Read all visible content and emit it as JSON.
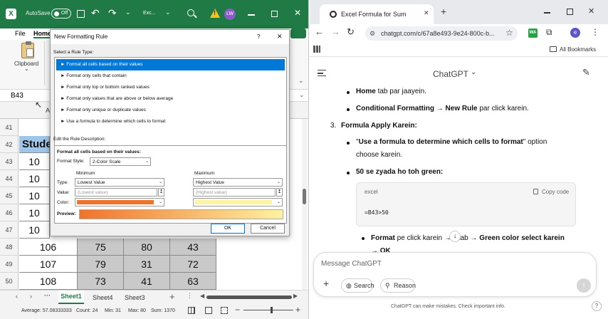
{
  "excel": {
    "autosave_label": "AutoSave",
    "autosave_state": "Off",
    "filename": "Exc...",
    "user_initials": "LW",
    "ribbon_tabs": [
      "File",
      "Home"
    ],
    "clipboard_label": "Clipboard",
    "namebox": "B43",
    "col_a": "A",
    "rows": [
      {
        "num": "41",
        "cells": []
      },
      {
        "num": "42",
        "cells": [
          "Stude"
        ]
      },
      {
        "num": "43",
        "cells": [
          "10"
        ]
      },
      {
        "num": "44",
        "cells": [
          "10"
        ]
      },
      {
        "num": "45",
        "cells": [
          "10"
        ]
      },
      {
        "num": "46",
        "cells": [
          "10"
        ]
      },
      {
        "num": "47",
        "cells": [
          "10"
        ]
      },
      {
        "num": "48",
        "cells": [
          "106",
          "75",
          "80",
          "43"
        ]
      },
      {
        "num": "49",
        "cells": [
          "107",
          "79",
          "31",
          "72"
        ]
      },
      {
        "num": "50",
        "cells": [
          "108",
          "73",
          "41",
          "63"
        ]
      }
    ],
    "sheets": [
      "Sheet1",
      "Sheet4",
      "Sheet3"
    ],
    "active_sheet": "Sheet1",
    "status": {
      "average": "Average: 57.08333333",
      "count": "Count: 24",
      "min": "Min: 31",
      "max": "Max: 80",
      "sum": "Sum: 1370"
    }
  },
  "dialog": {
    "title": "New Formatting Rule",
    "help": "?",
    "close": "✕",
    "select_rule_label": "Select a Rule Type:",
    "rule_types": [
      "► Format all cells based on their values",
      "► Format only cells that contain",
      "► Format only top or bottom ranked values",
      "► Format only values that are above or below average",
      "► Format only unique or duplicate values",
      "► Use a formula to determine which cells to format"
    ],
    "selected_rule_index": 0,
    "edit_desc_label": "Edit the Rule Description:",
    "desc_heading": "Format all cells based on their values:",
    "format_style_label": "Format Style:",
    "format_style_value": "2-Color Scale",
    "minimum_label": "Minimum",
    "maximum_label": "Maximum",
    "type_label": "Type:",
    "value_label": "Value:",
    "color_label": "Color:",
    "min_type": "Lowest Value",
    "max_type": "Highest Value",
    "min_value": "(Lowest value)",
    "max_value": "(Highest value)",
    "preview_label": "Preview:",
    "min_color": "#f0732a",
    "max_color": "#fff2a0",
    "ok_label": "OK",
    "cancel_label": "Cancel"
  },
  "browser": {
    "tab_title": "Excel Formula for Sum",
    "url": "chatgpt.com/c/67a8e493-9e24-800c-b...",
    "bookmarks_label": "All Bookmarks",
    "profile_initial": "e",
    "app_title": "ChatGPT",
    "chat_lines": {
      "l1_bold": "Home",
      "l1_rest": " tab par jaayein.",
      "l2_bold": "Conditional Formatting → New Rule",
      "l2_rest": " par click karein.",
      "step3_num": "3.",
      "step3_title": "Formula Apply Karein:",
      "l4_q1": "\"",
      "l4_bold": "Use a formula to determine which cells to format",
      "l4_rest": "\" option",
      "l4_cont": "choose karein.",
      "l5_bold": "50 se zyada ho toh green:",
      "l6_bold1": "Format",
      "l6_rest1": " pe click karein → ",
      "l6_rest2": "il tab → ",
      "l6_bold2": "Green color select karein",
      "l6_cont": "→ OK"
    },
    "code": {
      "lang": "excel",
      "copy_label": "Copy code",
      "content": "=B43>50"
    },
    "composer_placeholder": "Message ChatGPT",
    "search_label": "Search",
    "reason_label": "Reason",
    "footer": "ChatGPT can make mistakes. Check important info.",
    "help_glyph": "?"
  },
  "colors": {
    "excel_green": "#1f7a45",
    "selection_blue": "#0078d7",
    "student_header": "#9fc5e8",
    "grey_cells": "#c9c9c9"
  }
}
